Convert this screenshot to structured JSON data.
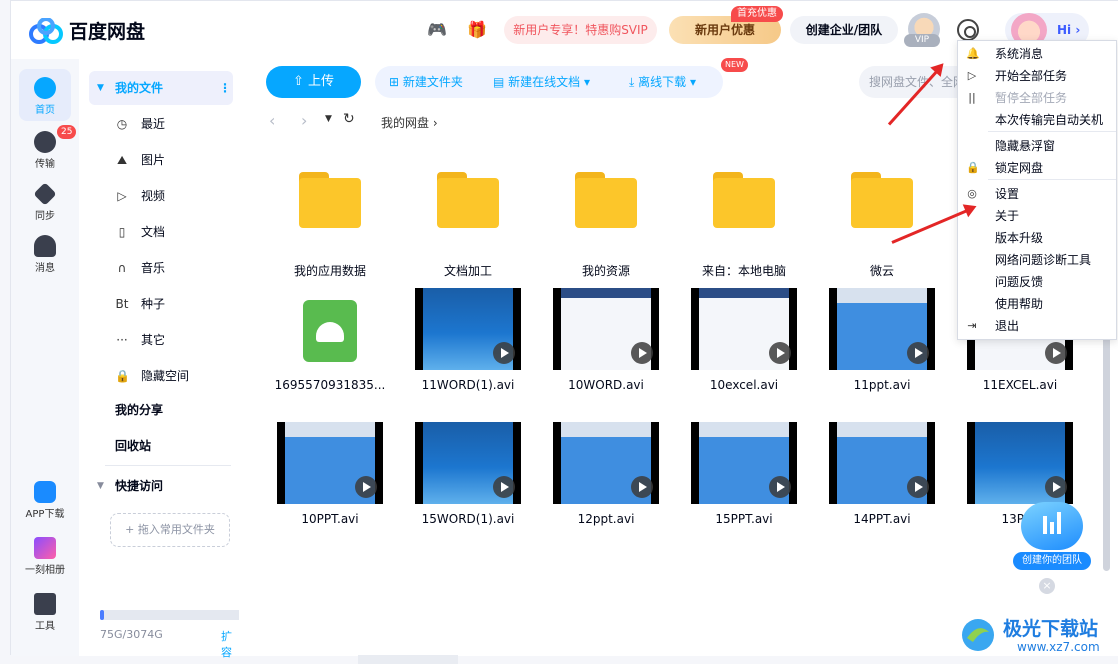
{
  "header": {
    "app_name": "百度网盘",
    "svip_promo": "新用户专享！特惠购SVIP",
    "new_user_deal": "新用户优惠",
    "first_charge_badge": "首充优惠",
    "enterprise_button": "创建企业/团队",
    "vip_tag": "VIP",
    "greeting": "Hi",
    "game_icon": "gamepad-icon",
    "gift_icon": "gift-icon",
    "settings_icon": "gear-icon"
  },
  "leftnav": {
    "items": [
      {
        "label": "首页",
        "icon": "cloud-home-icon"
      },
      {
        "label": "传输",
        "icon": "transfer-icon",
        "badge": "25"
      },
      {
        "label": "同步",
        "icon": "sync-icon"
      },
      {
        "label": "消息",
        "icon": "message-icon"
      }
    ],
    "bottom_items": [
      {
        "label": "APP下载",
        "icon": "phone-icon"
      },
      {
        "label": "一刻相册",
        "icon": "album-icon"
      },
      {
        "label": "工具",
        "icon": "tools-icon"
      }
    ]
  },
  "sidebar": {
    "my_files": "我的文件",
    "items": [
      {
        "label": "最近",
        "icon": "clock-icon",
        "glyph": "◷"
      },
      {
        "label": "图片",
        "icon": "image-icon",
        "glyph": "⛰"
      },
      {
        "label": "视频",
        "icon": "video-icon",
        "glyph": "▷"
      },
      {
        "label": "文档",
        "icon": "document-icon",
        "glyph": "▯"
      },
      {
        "label": "音乐",
        "icon": "headphones-icon",
        "glyph": "∩"
      },
      {
        "label": "种子",
        "icon": "torrent-icon",
        "glyph": "Bt"
      },
      {
        "label": "其它",
        "icon": "more-icon",
        "glyph": "···"
      },
      {
        "label": "隐藏空间",
        "icon": "lock-icon",
        "glyph": "🔒"
      }
    ],
    "my_share": "我的分享",
    "recycle_bin": "回收站",
    "quick_access": "快捷访问",
    "quick_add": "+ 拖入常用文件夹",
    "storage_text": "75G/3074G",
    "storage_fraction": 0.0244,
    "expand": "扩容"
  },
  "toolbar": {
    "upload": "上传",
    "new_folder": "新建文件夹",
    "new_online_doc": "新建在线文档",
    "new_badge": "NEW",
    "offline_download": "离线下载",
    "search_placeholder": "搜网盘文件、全网"
  },
  "breadcrumb": {
    "root": "我的网盘"
  },
  "files": {
    "row1": [
      {
        "name": "我的应用数据",
        "type": "folder"
      },
      {
        "name": "文档加工",
        "type": "folder"
      },
      {
        "name": "我的资源",
        "type": "folder"
      },
      {
        "name": "来自：本地电脑",
        "type": "folder"
      },
      {
        "name": "微云",
        "type": "folder"
      }
    ],
    "row2": [
      {
        "name": "1695570931835...",
        "type": "apk"
      },
      {
        "name": "11WORD(1).avi",
        "type": "blue"
      },
      {
        "name": "10WORD.avi",
        "type": "doc"
      },
      {
        "name": "10excel.avi",
        "type": "doc"
      },
      {
        "name": "11ppt.avi",
        "type": "win"
      },
      {
        "name": "11EXCEL.avi",
        "type": "doc"
      }
    ],
    "row3": [
      {
        "name": "10PPT.avi",
        "type": "win"
      },
      {
        "name": "15WORD(1).avi",
        "type": "blue"
      },
      {
        "name": "12ppt.avi",
        "type": "win"
      },
      {
        "name": "15PPT.avi",
        "type": "win"
      },
      {
        "name": "14PPT.avi",
        "type": "win"
      },
      {
        "name": "13PPT",
        "type": "blue"
      }
    ]
  },
  "menu": {
    "items": [
      {
        "label": "系统消息",
        "icon": "bell-icon",
        "glyph": "🔔",
        "disabled": false
      },
      {
        "label": "开始全部任务",
        "icon": "play-icon",
        "glyph": "▷",
        "disabled": false
      },
      {
        "label": "暂停全部任务",
        "icon": "pause-icon",
        "glyph": "||",
        "disabled": true
      },
      {
        "label": "本次传输完自动关机",
        "icon": "",
        "glyph": "",
        "disabled": false
      },
      {
        "label": "隐藏悬浮窗",
        "icon": "",
        "glyph": "",
        "disabled": false
      },
      {
        "label": "锁定网盘",
        "icon": "lock-icon",
        "glyph": "🔒",
        "disabled": false
      },
      {
        "label": "设置",
        "icon": "gear-icon",
        "glyph": "◎",
        "disabled": false
      },
      {
        "label": "关于",
        "icon": "",
        "glyph": "",
        "disabled": false
      },
      {
        "label": "版本升级",
        "icon": "",
        "glyph": "",
        "disabled": false
      },
      {
        "label": "网络问题诊断工具",
        "icon": "",
        "glyph": "",
        "disabled": false
      },
      {
        "label": "问题反馈",
        "icon": "",
        "glyph": "",
        "disabled": false
      },
      {
        "label": "使用帮助",
        "icon": "",
        "glyph": "",
        "disabled": false
      },
      {
        "label": "退出",
        "icon": "logout-icon",
        "glyph": "⇥",
        "disabled": false
      }
    ]
  },
  "team_float": {
    "label": "创建你的团队"
  },
  "watermark": {
    "title": "极光下载站",
    "url": "www.xz7.com"
  },
  "colors": {
    "accent": "#06a7ff",
    "folder": "#fcc62a",
    "arrow": "#e32626"
  }
}
